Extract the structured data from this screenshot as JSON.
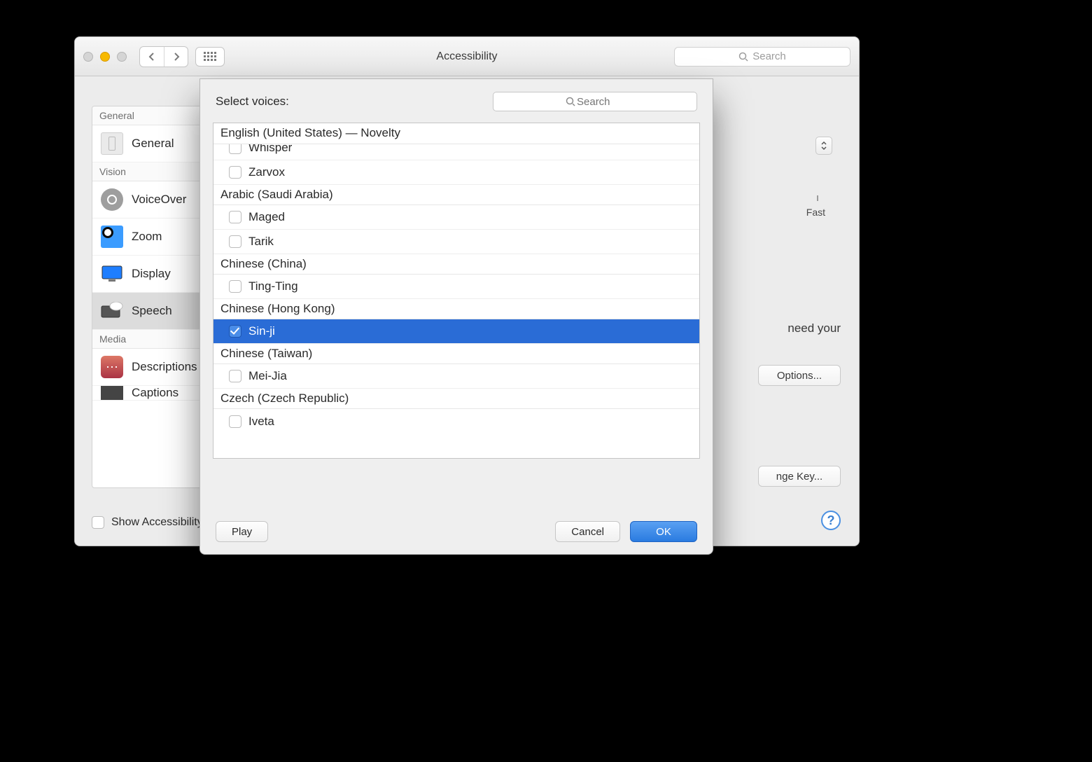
{
  "window": {
    "title": "Accessibility",
    "search_placeholder": "Search"
  },
  "sidebar": {
    "sections": [
      {
        "label": "General",
        "items": [
          {
            "label": "General"
          }
        ]
      },
      {
        "label": "Vision",
        "items": [
          {
            "label": "VoiceOver"
          },
          {
            "label": "Zoom"
          },
          {
            "label": "Display"
          },
          {
            "label": "Speech",
            "selected": true
          }
        ]
      },
      {
        "label": "Media",
        "items": [
          {
            "label": "Descriptions"
          },
          {
            "label": "Captions"
          }
        ]
      }
    ]
  },
  "footer": {
    "show_label": "Show Accessibility status in menu bar"
  },
  "right_frag": {
    "fast": "Fast",
    "need_your": "need your",
    "options": "Options...",
    "change_key": "nge Key..."
  },
  "sheet": {
    "title": "Select voices:",
    "search_placeholder": "Search",
    "sticky_group": "English (United States) — Novelty",
    "groups": [
      {
        "label": "English (United States) — Novelty",
        "hidden_header": true,
        "voices": [
          {
            "name": "Whisper",
            "partial": true
          },
          {
            "name": "Zarvox"
          }
        ]
      },
      {
        "label": "Arabic (Saudi Arabia)",
        "voices": [
          {
            "name": "Maged"
          },
          {
            "name": "Tarik"
          }
        ]
      },
      {
        "label": "Chinese (China)",
        "voices": [
          {
            "name": "Ting-Ting"
          }
        ]
      },
      {
        "label": "Chinese (Hong Kong)",
        "voices": [
          {
            "name": "Sin-ji",
            "checked": true,
            "selected": true
          }
        ]
      },
      {
        "label": "Chinese (Taiwan)",
        "voices": [
          {
            "name": "Mei-Jia"
          }
        ]
      },
      {
        "label": "Czech (Czech Republic)",
        "voices": [
          {
            "name": "Iveta",
            "partial_bottom": true
          }
        ]
      }
    ],
    "buttons": {
      "play": "Play",
      "cancel": "Cancel",
      "ok": "OK"
    }
  }
}
